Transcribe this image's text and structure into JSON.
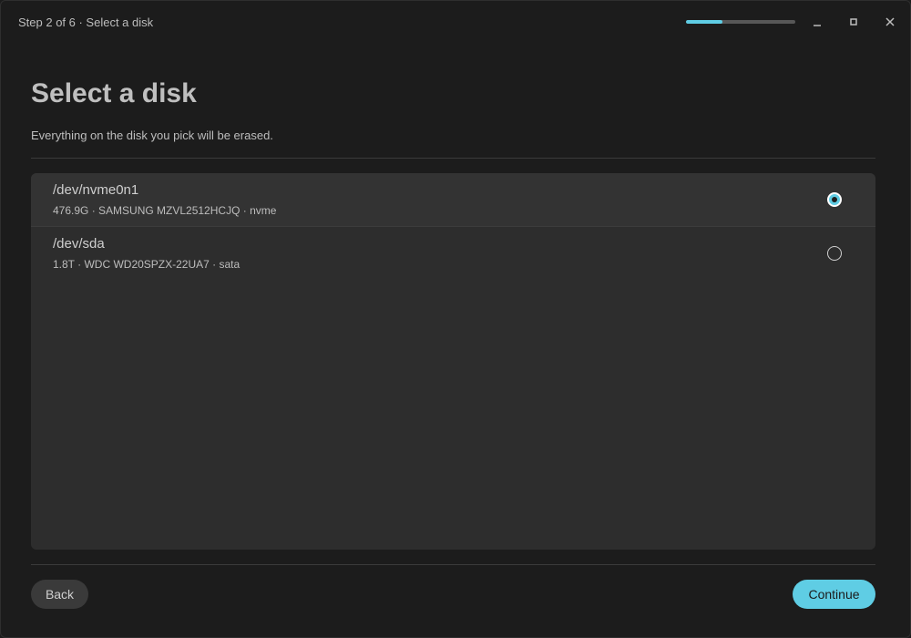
{
  "window": {
    "title": "Step 2 of 6 · Select a disk",
    "progress_fraction": 0.333,
    "controls": {
      "minimize_icon": "minimize-icon",
      "maximize_icon": "maximize-icon",
      "close_icon": "close-icon"
    }
  },
  "page": {
    "heading": "Select a disk",
    "subtitle": "Everything on the disk you pick will be erased."
  },
  "disks": [
    {
      "name": "/dev/nvme0n1",
      "details": "476.9G · SAMSUNG MZVL2512HCJQ · nvme",
      "selected": true
    },
    {
      "name": "/dev/sda",
      "details": "1.8T · WDC WD20SPZX-22UA7 · sata",
      "selected": false
    }
  ],
  "footer": {
    "back_label": "Back",
    "continue_label": "Continue"
  },
  "colors": {
    "accent": "#5fcde4",
    "background": "#1c1c1c",
    "panel": "#2d2d2d"
  }
}
